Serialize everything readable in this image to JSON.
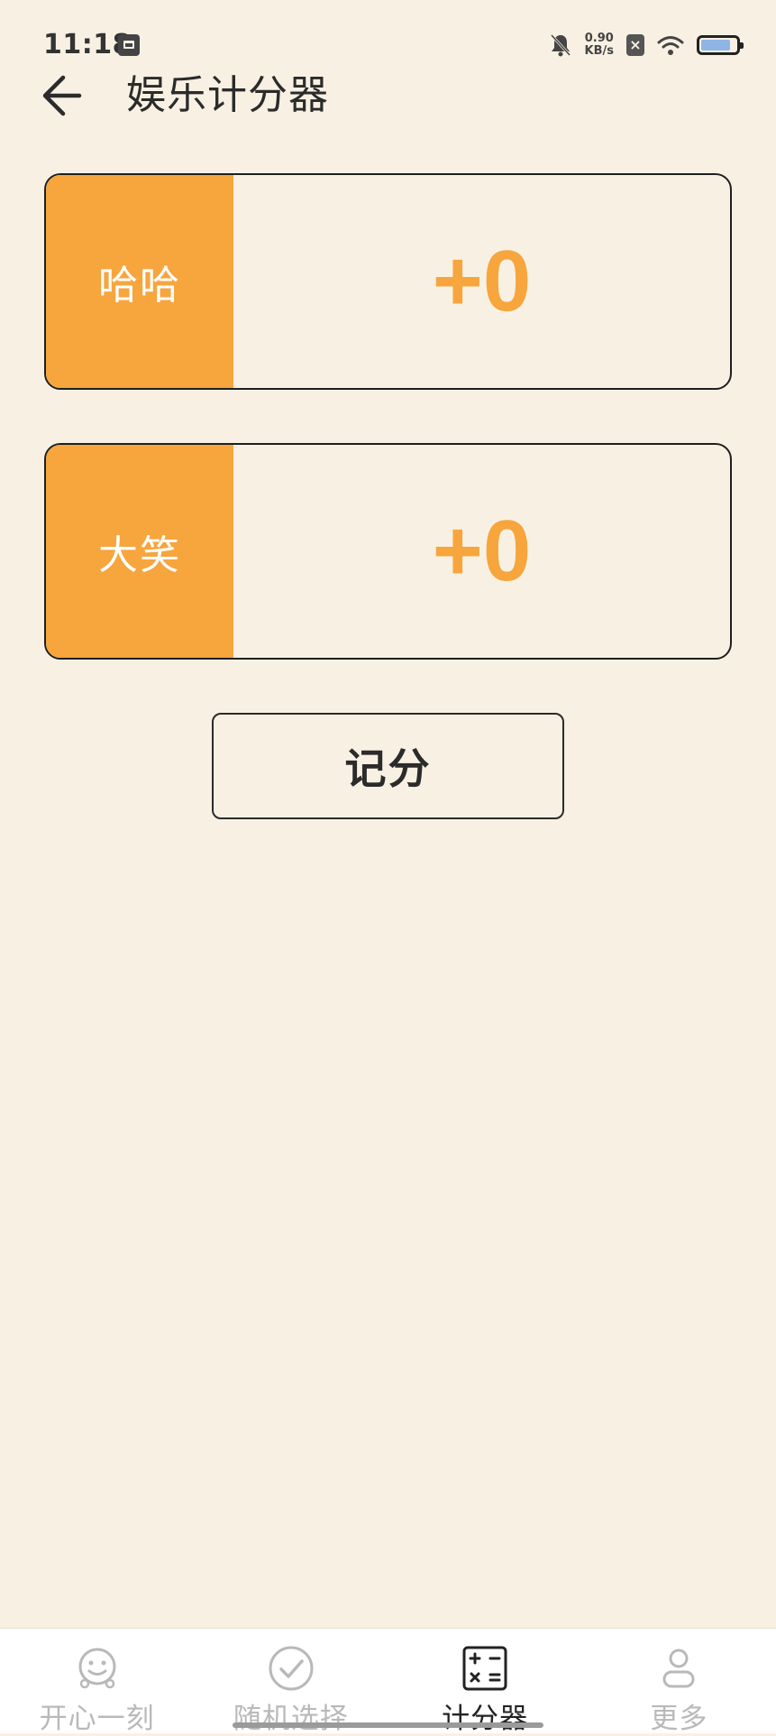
{
  "status_bar": {
    "time": "11:18",
    "net_speed_value": "0.90",
    "net_speed_unit": "KB/s",
    "battery_level": 0.85
  },
  "header": {
    "title": "娱乐计分器"
  },
  "players": [
    {
      "name": "哈哈",
      "score": "+0"
    },
    {
      "name": "大笑",
      "score": "+0"
    }
  ],
  "actions": {
    "record_label": "记分"
  },
  "bottom_nav": {
    "items": [
      {
        "label": "开心一刻",
        "icon": "smiley-face-icon",
        "active": false
      },
      {
        "label": "随机选择",
        "icon": "check-circle-icon",
        "active": false
      },
      {
        "label": "计分器",
        "icon": "calculator-icon",
        "active": true
      },
      {
        "label": "更多",
        "icon": "person-icon",
        "active": false
      }
    ]
  },
  "colors": {
    "background": "#f8f1e3",
    "accent": "#f7a53d",
    "text": "#2b2b2b",
    "nav_inactive": "#b9b9b9"
  }
}
